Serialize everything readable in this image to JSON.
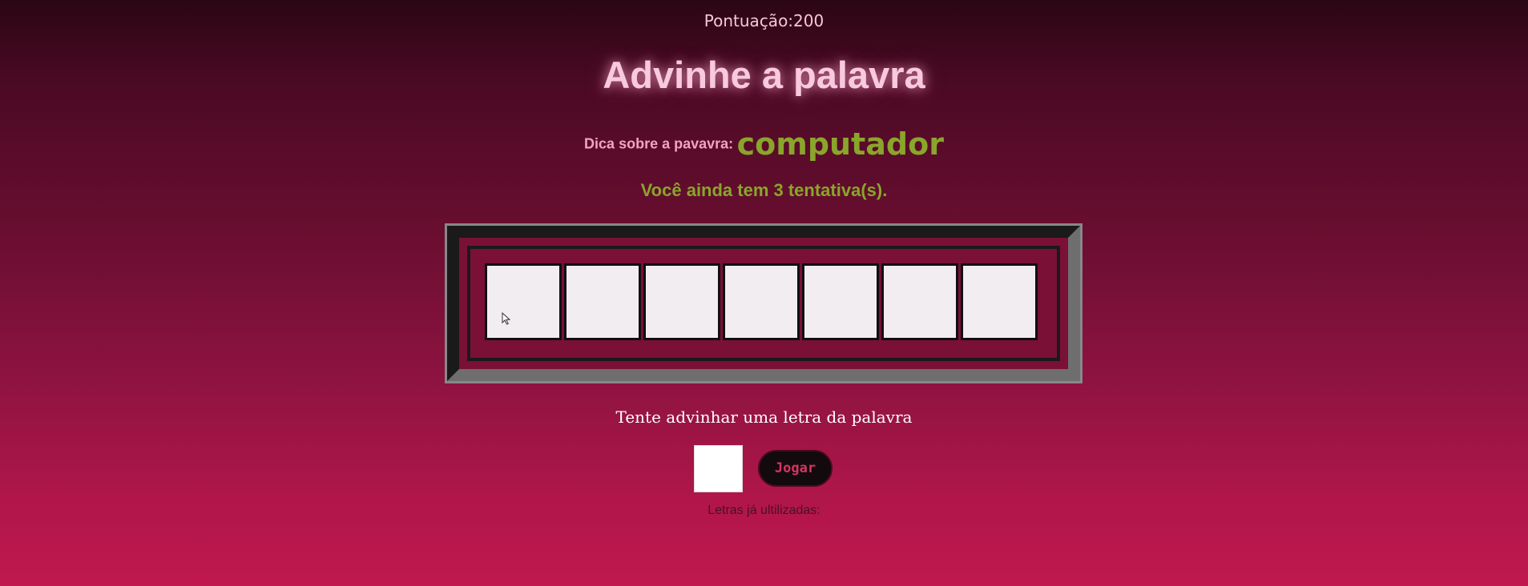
{
  "score": {
    "text": "Pontuação:200"
  },
  "title": "Advinhe a palavra",
  "hint": {
    "label": "Dica sobre a pavavra:",
    "word": "computador"
  },
  "attempts_text": "Você ainda tem 3 tentativa(s).",
  "board": {
    "slots": [
      "",
      "",
      "",
      "",
      "",
      "",
      ""
    ]
  },
  "guess": {
    "prompt": "Tente advinhar uma letra da palavra",
    "input_value": "",
    "button_label": "Jogar"
  },
  "used_letters": {
    "label": "Letras já ultilizadas:"
  },
  "colors": {
    "background_top": "#2b0614",
    "background_bottom": "#c0184f",
    "title": "#f9c9dc",
    "hint_label": "#f2a3c2",
    "accent_green": "#8aa52b",
    "board_fill": "#7a1035",
    "button_text": "#d63464"
  }
}
